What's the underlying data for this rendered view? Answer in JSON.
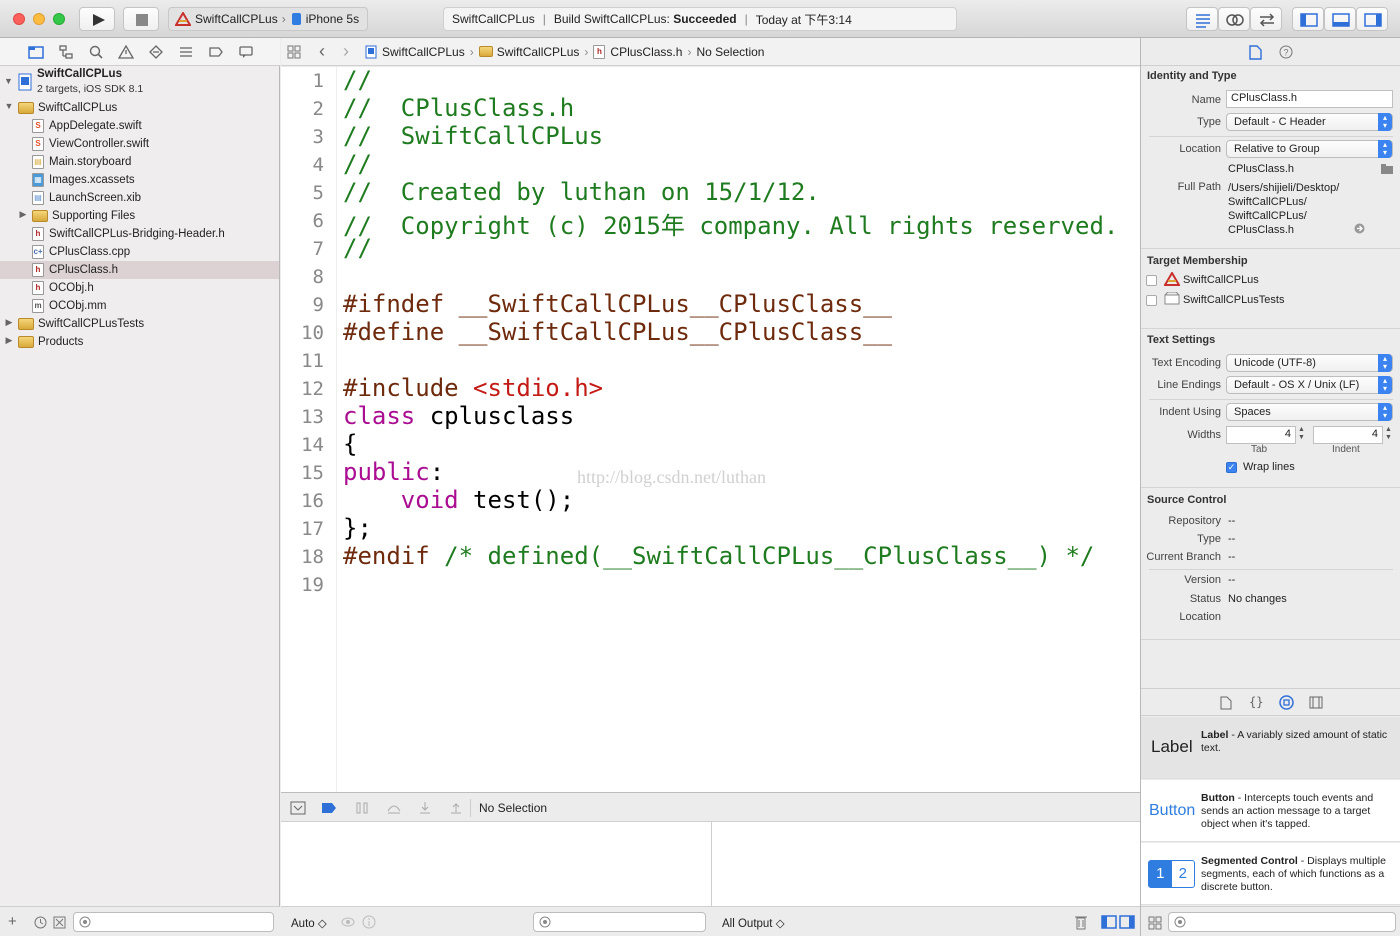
{
  "toolbar": {
    "scheme_target": "SwiftCallCPLus",
    "scheme_device": "iPhone 5s",
    "activity_project": "SwiftCallCPLus",
    "activity_build_prefix": "Build SwiftCallCPLus: ",
    "activity_build_status": "Succeeded",
    "activity_time": "Today at 下午3:14"
  },
  "navigator": {
    "project_name": "SwiftCallCPLus",
    "project_sub": "2 targets, iOS SDK 8.1",
    "items": [
      {
        "label": "SwiftCallCPLus",
        "kind": "folder",
        "disclosure": "▼"
      },
      {
        "label": "AppDelegate.swift",
        "kind": "swift",
        "icon_text": "S"
      },
      {
        "label": "ViewController.swift",
        "kind": "swift",
        "icon_text": "S"
      },
      {
        "label": "Main.storyboard",
        "kind": "storyboard",
        "icon_text": "▤"
      },
      {
        "label": "Images.xcassets",
        "kind": "assets",
        "icon_text": "▦"
      },
      {
        "label": "LaunchScreen.xib",
        "kind": "xib",
        "icon_text": "▤"
      },
      {
        "label": "Supporting Files",
        "kind": "folder",
        "disclosure": "▶"
      },
      {
        "label": "SwiftCallCPLus-Bridging-Header.h",
        "kind": "header",
        "icon_text": "h"
      },
      {
        "label": "CPlusClass.cpp",
        "kind": "cpp",
        "icon_text": "c+"
      },
      {
        "label": "CPlusClass.h",
        "kind": "header",
        "icon_text": "h",
        "selected": true
      },
      {
        "label": "OCObj.h",
        "kind": "header",
        "icon_text": "h"
      },
      {
        "label": "OCObj.mm",
        "kind": "objcpp",
        "icon_text": "m"
      },
      {
        "label": "SwiftCallCPLusTests",
        "kind": "folder",
        "disclosure": "▶"
      },
      {
        "label": "Products",
        "kind": "folder",
        "disclosure": "▶"
      }
    ]
  },
  "jumpbar": {
    "crumbs": [
      "SwiftCallCPLus",
      "SwiftCallCPLus",
      "CPlusClass.h",
      "No Selection"
    ]
  },
  "editor": {
    "line_numbers": [
      "1",
      "2",
      "3",
      "4",
      "5",
      "6",
      "7",
      "8",
      "9",
      "10",
      "11",
      "12",
      "13",
      "14",
      "15",
      "16",
      "17",
      "18",
      "19"
    ],
    "lines": [
      [
        {
          "t": "//",
          "c": "com"
        }
      ],
      [
        {
          "t": "//  CPlusClass.h",
          "c": "com"
        }
      ],
      [
        {
          "t": "//  SwiftCallCPLus",
          "c": "com"
        }
      ],
      [
        {
          "t": "//",
          "c": "com"
        }
      ],
      [
        {
          "t": "//  Created by luthan on 15/1/12.",
          "c": "com"
        }
      ],
      [
        {
          "t": "//  Copyright (c) 2015年 company. All rights reserved.",
          "c": "com"
        }
      ],
      [
        {
          "t": "//",
          "c": "com"
        }
      ],
      [],
      [
        {
          "t": "#ifndef __SwiftCallCPLus__CPlusClass__",
          "c": "pp"
        }
      ],
      [
        {
          "t": "#define __SwiftCallCPLus__CPlusClass__",
          "c": "pp"
        }
      ],
      [],
      [
        {
          "t": "#include ",
          "c": "pp"
        },
        {
          "t": "<stdio.h>",
          "c": "str"
        }
      ],
      [
        {
          "t": "class",
          "c": "kw"
        },
        {
          "t": " cplusclass",
          "c": ""
        }
      ],
      [
        {
          "t": "{",
          "c": ""
        }
      ],
      [
        {
          "t": "public",
          "c": "kw"
        },
        {
          "t": ":",
          "c": ""
        }
      ],
      [
        {
          "t": "    ",
          "c": ""
        },
        {
          "t": "void",
          "c": "kw"
        },
        {
          "t": " test();",
          "c": ""
        }
      ],
      [
        {
          "t": "};",
          "c": ""
        }
      ],
      [
        {
          "t": "#endif ",
          "c": "pp"
        },
        {
          "t": "/* defined(__SwiftCallCPLus__CPlusClass__) */",
          "c": "com"
        }
      ],
      []
    ],
    "watermark": "http://blog.csdn.net/luthan"
  },
  "debug": {
    "selection": "No Selection",
    "variables_scope": "Auto ◇",
    "output_scope": "All Output ◇"
  },
  "inspector": {
    "identity_title": "Identity and Type",
    "name_label": "Name",
    "name_value": "CPlusClass.h",
    "type_label": "Type",
    "type_value": "Default - C Header",
    "location_label": "Location",
    "location_value": "Relative to Group",
    "location_file": "CPlusClass.h",
    "fullpath_label": "Full Path",
    "fullpath_lines": [
      "/Users/shijieli/Desktop/",
      "SwiftCallCPLus/",
      "SwiftCallCPLus/",
      "CPlusClass.h"
    ],
    "target_title": "Target Membership",
    "targets": [
      "SwiftCallCPLus",
      "SwiftCallCPLusTests"
    ],
    "text_title": "Text Settings",
    "encoding_label": "Text Encoding",
    "encoding_value": "Unicode (UTF-8)",
    "endings_label": "Line Endings",
    "endings_value": "Default - OS X / Unix (LF)",
    "indent_label": "Indent Using",
    "indent_value": "Spaces",
    "widths_label": "Widths",
    "tab_value": "4",
    "indent_width_value": "4",
    "tab_caption": "Tab",
    "indent_caption": "Indent",
    "wrap_label": "Wrap lines",
    "source_title": "Source Control",
    "repository_label": "Repository",
    "repository_value": "--",
    "sc_type_label": "Type",
    "sc_type_value": "--",
    "branch_label": "Current Branch",
    "branch_value": "--",
    "version_label": "Version",
    "version_value": "--",
    "status_label": "Status",
    "status_value": "No changes",
    "sc_location_label": "Location"
  },
  "library": {
    "items": [
      {
        "glyph": "Label",
        "title": "Label",
        "desc": " - A variably sized amount of static text."
      },
      {
        "glyph": "Button",
        "title": "Button",
        "desc": " - Intercepts touch events and sends an action message to a target object when it's tapped."
      },
      {
        "glyph": "",
        "title": "Segmented Control",
        "desc": " - Displays multiple segments, each of which functions as a discrete button.",
        "seg1": "1",
        "seg2": "2"
      }
    ]
  },
  "colors": {
    "comment": "#1f7b1f",
    "preprocessor": "#6e2a0c",
    "string": "#c41a16",
    "keyword": "#aa0d91",
    "accent": "#3a83f1"
  }
}
